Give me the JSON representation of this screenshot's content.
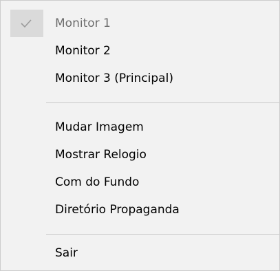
{
  "menu": {
    "group_monitors": [
      {
        "label": "Monitor 1",
        "checked": true,
        "disabled": true
      },
      {
        "label": "Monitor 2",
        "checked": false,
        "disabled": false
      },
      {
        "label": "Monitor 3 (Principal)",
        "checked": false,
        "disabled": false
      }
    ],
    "group_actions": [
      {
        "label": "Mudar Imagem"
      },
      {
        "label": "Mostrar Relogio"
      },
      {
        "label": "Com do Fundo"
      },
      {
        "label": "Diretório Propaganda"
      }
    ],
    "group_exit": [
      {
        "label": "Sair"
      }
    ],
    "colors": {
      "menu_background": "#f2f2f2",
      "disabled_text": "#6d6d6d",
      "check_background": "#dadada",
      "separator": "#c8c8c8"
    },
    "icons": {
      "checked": "checkmark-icon"
    }
  }
}
